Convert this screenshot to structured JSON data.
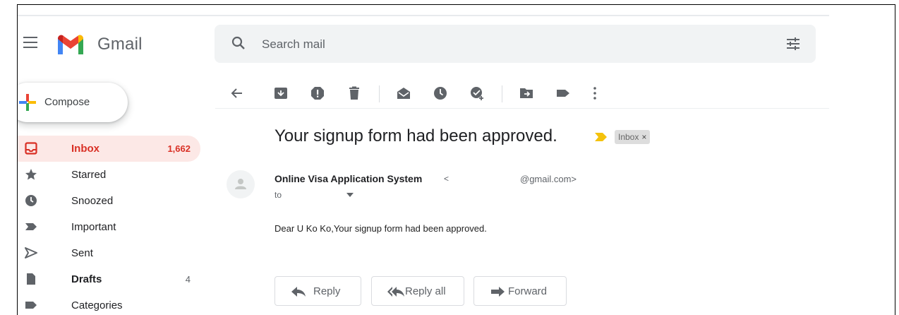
{
  "header": {
    "brand": "Gmail",
    "search_placeholder": "Search mail"
  },
  "compose": {
    "label": "Compose"
  },
  "sidebar": {
    "items": [
      {
        "label": "Inbox",
        "count": "1,662",
        "icon": "inbox-icon"
      },
      {
        "label": "Starred",
        "count": "",
        "icon": "star-icon"
      },
      {
        "label": "Snoozed",
        "count": "",
        "icon": "clock-icon"
      },
      {
        "label": "Important",
        "count": "",
        "icon": "important-icon"
      },
      {
        "label": "Sent",
        "count": "",
        "icon": "send-icon"
      },
      {
        "label": "Drafts",
        "count": "4",
        "icon": "draft-icon"
      },
      {
        "label": "Categories",
        "count": "",
        "icon": "label-icon"
      }
    ]
  },
  "toolbar": {
    "icons": [
      "back-icon",
      "archive-icon",
      "report-spam-icon",
      "delete-icon",
      "mark-unread-icon",
      "snooze-icon",
      "add-to-tasks-icon",
      "move-to-icon",
      "label-icon",
      "more-icon"
    ]
  },
  "email": {
    "subject": "Your signup form had been approved.",
    "label_chip": "Inbox",
    "label_chip_close": "×",
    "sender_name": "Online Visa Application System",
    "sender_open": "<",
    "sender_email": "@gmail.com>",
    "to": "to",
    "body": "Dear U Ko Ko,Your signup form had been approved."
  },
  "actions": {
    "reply": "Reply",
    "reply_all": "Reply all",
    "forward": "Forward"
  },
  "colors": {
    "accent_red": "#d93025",
    "active_bg": "#fce8e6",
    "important_yellow": "#f4c20d",
    "icon_gray": "#5f6368"
  }
}
